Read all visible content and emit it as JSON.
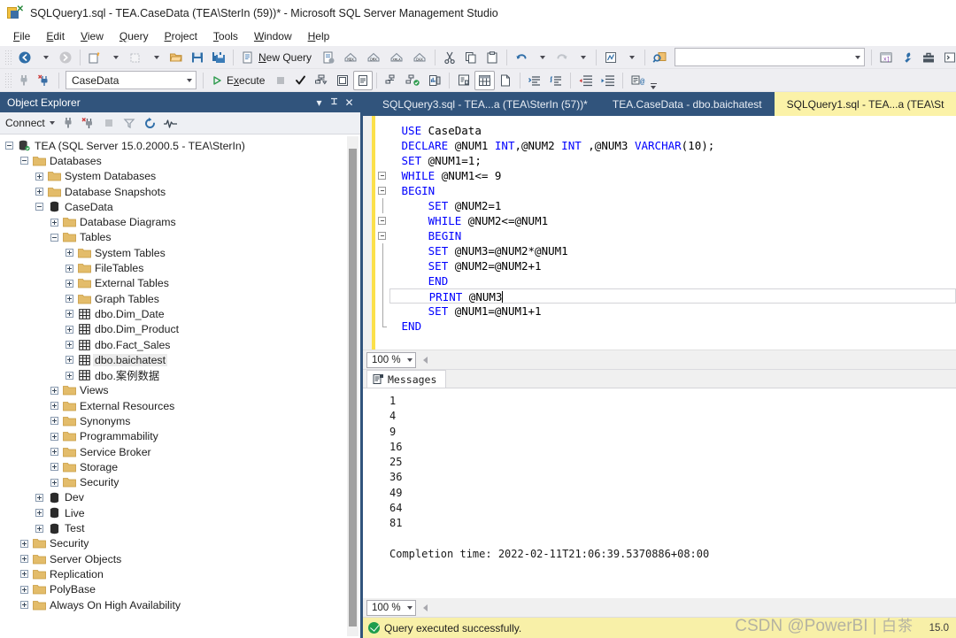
{
  "window": {
    "title": "SQLQuery1.sql - TEA.CaseData (TEA\\SterIn (59))* - Microsoft SQL Server Management Studio",
    "icon": "ssms-icon"
  },
  "menubar": {
    "items": [
      {
        "label": "File",
        "accel": "F"
      },
      {
        "label": "Edit",
        "accel": "E"
      },
      {
        "label": "View",
        "accel": "V"
      },
      {
        "label": "Query",
        "accel": "Q"
      },
      {
        "label": "Project",
        "accel": "P"
      },
      {
        "label": "Tools",
        "accel": "T"
      },
      {
        "label": "Window",
        "accel": "W"
      },
      {
        "label": "Help",
        "accel": "H"
      }
    ]
  },
  "toolbar_main": {
    "buttons": [
      {
        "name": "navigate-backward-icon",
        "label": ""
      },
      {
        "name": "navigate-forward-icon",
        "label": ""
      },
      {
        "name": "new-project-icon",
        "label": ""
      },
      {
        "name": "open-project-icon",
        "label": ""
      },
      {
        "name": "open-file-icon",
        "label": ""
      },
      {
        "name": "save-icon",
        "label": ""
      },
      {
        "name": "save-all-icon",
        "label": ""
      },
      {
        "name": "new-query-icon",
        "label": "New Query",
        "accel": "N"
      },
      {
        "name": "new-query-current-connection-icon",
        "label": ""
      },
      {
        "name": "new-mdx-query-icon",
        "label": "MDX"
      },
      {
        "name": "new-dmx-query-icon",
        "label": "DMX"
      },
      {
        "name": "new-xmla-query-icon",
        "label": "XMLA"
      },
      {
        "name": "new-dax-query-icon",
        "label": "DAX"
      },
      {
        "name": "cut-icon",
        "label": ""
      },
      {
        "name": "copy-icon",
        "label": ""
      },
      {
        "name": "paste-icon",
        "label": ""
      },
      {
        "name": "undo-icon",
        "label": ""
      },
      {
        "name": "redo-icon",
        "label": ""
      },
      {
        "name": "registered-servers-icon",
        "label": ""
      },
      {
        "name": "find-icon",
        "label": ""
      },
      {
        "name": "solution-explorer-icon",
        "label": ""
      },
      {
        "name": "properties-window-icon",
        "label": ""
      },
      {
        "name": "toolbox-icon",
        "label": ""
      },
      {
        "name": "command-window-icon",
        "label": ""
      }
    ],
    "search_placeholder": ""
  },
  "toolbar_query": {
    "database_value": "CaseData",
    "execute_label": "Execute",
    "execute_accel": "x",
    "buttons": [
      {
        "name": "connect-icon"
      },
      {
        "name": "change-connection-icon"
      },
      {
        "name": "execute-icon"
      },
      {
        "name": "stop-icon"
      },
      {
        "name": "parse-icon"
      },
      {
        "name": "display-estimated-plan-icon"
      },
      {
        "name": "query-options-icon"
      },
      {
        "name": "results-to-text-icon"
      },
      {
        "name": "include-actual-plan-icon"
      },
      {
        "name": "include-live-query-stats-icon"
      },
      {
        "name": "include-client-statistics-icon"
      },
      {
        "name": "results-to-grid-icon"
      },
      {
        "name": "results-to-file-icon"
      },
      {
        "name": "comment-lines-icon"
      },
      {
        "name": "uncomment-lines-icon"
      },
      {
        "name": "decrease-indent-icon"
      },
      {
        "name": "increase-indent-icon"
      },
      {
        "name": "specify-values-for-template-parameters-icon"
      }
    ]
  },
  "object_explorer": {
    "title": "Object Explorer",
    "header_buttons": [
      {
        "name": "window-position-icon",
        "glyph": "▾"
      },
      {
        "name": "auto-hide-pin-icon",
        "glyph": "⊥"
      },
      {
        "name": "close-icon",
        "glyph": "✕"
      }
    ],
    "connect_label": "Connect",
    "toolbar_buttons": [
      {
        "name": "connect-object-explorer-icon"
      },
      {
        "name": "disconnect-icon"
      },
      {
        "name": "stop-icon"
      },
      {
        "name": "filter-icon"
      },
      {
        "name": "refresh-icon"
      },
      {
        "name": "activity-monitor-icon"
      }
    ],
    "tree": [
      {
        "label": "TEA (SQL Server 15.0.2000.5 - TEA\\SterIn)",
        "depth": 0,
        "state": "minus",
        "icon": "server-icon"
      },
      {
        "label": "Databases",
        "depth": 1,
        "state": "minus",
        "icon": "folder-icon"
      },
      {
        "label": "System Databases",
        "depth": 2,
        "state": "plus",
        "icon": "folder-icon"
      },
      {
        "label": "Database Snapshots",
        "depth": 2,
        "state": "plus",
        "icon": "folder-icon"
      },
      {
        "label": "CaseData",
        "depth": 2,
        "state": "minus",
        "icon": "database-icon"
      },
      {
        "label": "Database Diagrams",
        "depth": 3,
        "state": "plus",
        "icon": "folder-icon"
      },
      {
        "label": "Tables",
        "depth": 3,
        "state": "minus",
        "icon": "folder-icon"
      },
      {
        "label": "System Tables",
        "depth": 4,
        "state": "plus",
        "icon": "folder-icon"
      },
      {
        "label": "FileTables",
        "depth": 4,
        "state": "plus",
        "icon": "folder-icon"
      },
      {
        "label": "External Tables",
        "depth": 4,
        "state": "plus",
        "icon": "folder-icon"
      },
      {
        "label": "Graph Tables",
        "depth": 4,
        "state": "plus",
        "icon": "folder-icon"
      },
      {
        "label": "dbo.Dim_Date",
        "depth": 4,
        "state": "plus",
        "icon": "table-icon"
      },
      {
        "label": "dbo.Dim_Product",
        "depth": 4,
        "state": "plus",
        "icon": "table-icon"
      },
      {
        "label": "dbo.Fact_Sales",
        "depth": 4,
        "state": "plus",
        "icon": "table-icon"
      },
      {
        "label": "dbo.baichatest",
        "depth": 4,
        "state": "plus",
        "icon": "table-icon",
        "selected": true
      },
      {
        "label": "dbo.案例数据",
        "depth": 4,
        "state": "plus",
        "icon": "table-icon"
      },
      {
        "label": "Views",
        "depth": 3,
        "state": "plus",
        "icon": "folder-icon"
      },
      {
        "label": "External Resources",
        "depth": 3,
        "state": "plus",
        "icon": "folder-icon"
      },
      {
        "label": "Synonyms",
        "depth": 3,
        "state": "plus",
        "icon": "folder-icon"
      },
      {
        "label": "Programmability",
        "depth": 3,
        "state": "plus",
        "icon": "folder-icon"
      },
      {
        "label": "Service Broker",
        "depth": 3,
        "state": "plus",
        "icon": "folder-icon"
      },
      {
        "label": "Storage",
        "depth": 3,
        "state": "plus",
        "icon": "folder-icon"
      },
      {
        "label": "Security",
        "depth": 3,
        "state": "plus",
        "icon": "folder-icon"
      },
      {
        "label": "Dev",
        "depth": 2,
        "state": "plus",
        "icon": "database-icon"
      },
      {
        "label": "Live",
        "depth": 2,
        "state": "plus",
        "icon": "database-icon"
      },
      {
        "label": "Test",
        "depth": 2,
        "state": "plus",
        "icon": "database-icon"
      },
      {
        "label": "Security",
        "depth": 1,
        "state": "plus",
        "icon": "folder-icon"
      },
      {
        "label": "Server Objects",
        "depth": 1,
        "state": "plus",
        "icon": "folder-icon"
      },
      {
        "label": "Replication",
        "depth": 1,
        "state": "plus",
        "icon": "folder-icon"
      },
      {
        "label": "PolyBase",
        "depth": 1,
        "state": "plus",
        "icon": "folder-icon"
      },
      {
        "label": "Always On High Availability",
        "depth": 1,
        "state": "plus",
        "icon": "folder-icon"
      }
    ]
  },
  "editor_tabs": [
    {
      "label": "SQLQuery3.sql - TEA...a (TEA\\SterIn (57))*",
      "active": false
    },
    {
      "label": "TEA.CaseData - dbo.baichatest",
      "active": false
    },
    {
      "label": "SQLQuery1.sql - TEA...a (TEA\\St",
      "active": true
    }
  ],
  "code": {
    "lines": [
      {
        "indent": 0,
        "fold": "none",
        "tokens": [
          {
            "t": "USE",
            "c": "kw"
          },
          {
            "t": " CaseData",
            "c": "var"
          }
        ]
      },
      {
        "indent": 0,
        "fold": "none",
        "tokens": [
          {
            "t": "DECLARE",
            "c": "kw"
          },
          {
            "t": " @NUM1 ",
            "c": "var"
          },
          {
            "t": "INT",
            "c": "kw"
          },
          {
            "t": ",@NUM2 ",
            "c": "var"
          },
          {
            "t": "INT",
            "c": "kw"
          },
          {
            "t": " ,@NUM3 ",
            "c": "var"
          },
          {
            "t": "VARCHAR",
            "c": "kw"
          },
          {
            "t": "(10);",
            "c": "var"
          }
        ]
      },
      {
        "indent": 0,
        "fold": "none",
        "tokens": [
          {
            "t": "SET",
            "c": "kw"
          },
          {
            "t": " @NUM1=1;",
            "c": "var"
          }
        ]
      },
      {
        "indent": 0,
        "fold": "box",
        "tokens": [
          {
            "t": "WHILE",
            "c": "kw"
          },
          {
            "t": " @NUM1<= 9",
            "c": "var"
          }
        ]
      },
      {
        "indent": 0,
        "fold": "box",
        "tokens": [
          {
            "t": "BEGIN",
            "c": "kw"
          }
        ]
      },
      {
        "indent": 1,
        "fold": "line",
        "tokens": [
          {
            "t": "SET",
            "c": "kw"
          },
          {
            "t": " @NUM2=1",
            "c": "var"
          }
        ]
      },
      {
        "indent": 1,
        "fold": "box2",
        "tokens": [
          {
            "t": "WHILE",
            "c": "kw"
          },
          {
            "t": " @NUM2<=@NUM1",
            "c": "var"
          }
        ]
      },
      {
        "indent": 1,
        "fold": "box2",
        "tokens": [
          {
            "t": "BEGIN",
            "c": "kw"
          }
        ]
      },
      {
        "indent": 1,
        "fold": "line",
        "tokens": [
          {
            "t": "SET",
            "c": "kw"
          },
          {
            "t": " @NUM3=@NUM2*@NUM1",
            "c": "var"
          }
        ]
      },
      {
        "indent": 1,
        "fold": "line",
        "tokens": [
          {
            "t": "SET",
            "c": "kw"
          },
          {
            "t": " @NUM2=@NUM2+1",
            "c": "var"
          }
        ]
      },
      {
        "indent": 1,
        "fold": "line",
        "tokens": [
          {
            "t": "END",
            "c": "kw"
          }
        ]
      },
      {
        "indent": 1,
        "fold": "line",
        "current": true,
        "tokens": [
          {
            "t": "PRINT",
            "c": "kw"
          },
          {
            "t": " @NUM3",
            "c": "var"
          }
        ]
      },
      {
        "indent": 1,
        "fold": "line",
        "tokens": [
          {
            "t": "SET",
            "c": "kw"
          },
          {
            "t": " @NUM1=@NUM1+1",
            "c": "var"
          }
        ]
      },
      {
        "indent": 0,
        "fold": "end",
        "tokens": [
          {
            "t": "END",
            "c": "kw"
          }
        ]
      }
    ]
  },
  "editor_zoom": {
    "value": "100 %"
  },
  "results": {
    "tab_label": "Messages",
    "tab_icon": "messages-icon",
    "messages": [
      "1",
      "4",
      "9",
      "16",
      "25",
      "36",
      "49",
      "64",
      "81",
      "",
      "Completion time: 2022-02-11T21:06:39.5370886+08:00"
    ],
    "zoom": {
      "value": "100 %"
    }
  },
  "statusbar": {
    "text": "Query executed successfully.",
    "right_text": "15.0",
    "status_icon": "success-check-icon"
  },
  "watermark": {
    "text": "CSDN @PowerBI",
    "separator": "|",
    "cjk": "白茶"
  },
  "colors": {
    "accent_blue": "#31547c",
    "keyword_blue": "#0000ff",
    "status_yellow": "#f8f0a8",
    "tab_active_yellow": "#fbf2a8",
    "change_bar_yellow": "#fbe04a",
    "folder_tan": "#e3bc6a"
  }
}
